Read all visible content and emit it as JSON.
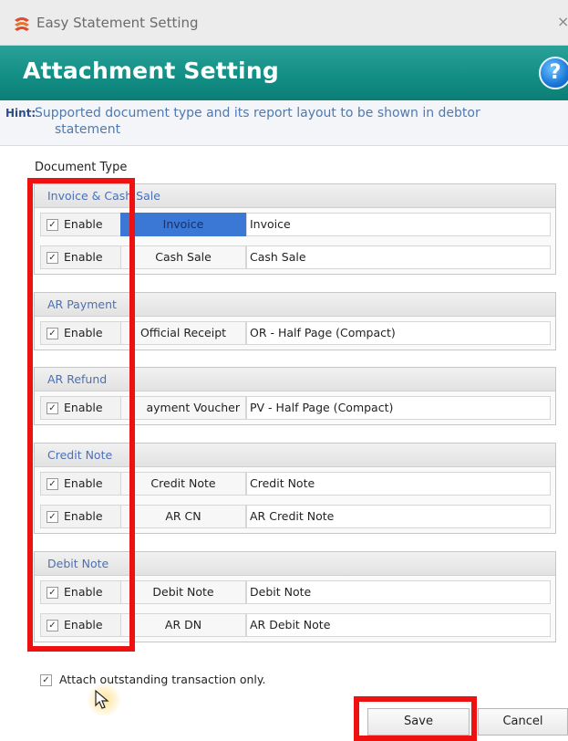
{
  "window": {
    "title": "Easy Statement Setting",
    "close_glyph": "×"
  },
  "header": {
    "title": "Attachment Setting",
    "help_glyph": "?"
  },
  "hint": {
    "label": "Hint:",
    "line1": "Supported document type and its report layout to be shown in debtor",
    "line2": "statement"
  },
  "document_type_label": "Document Type",
  "enable_label": "Enable",
  "groups": [
    {
      "name": "Invoice & Cash Sale",
      "rows": [
        {
          "enabled": true,
          "doc": "Invoice",
          "layout": "Invoice",
          "selected": true
        },
        {
          "enabled": true,
          "doc": "Cash Sale",
          "layout": "Cash Sale"
        }
      ]
    },
    {
      "name": "AR Payment",
      "rows": [
        {
          "enabled": true,
          "doc": "Official Receipt",
          "layout": "OR - Half Page (Compact)"
        }
      ]
    },
    {
      "name": "AR Refund",
      "rows": [
        {
          "enabled": true,
          "doc": "ayment Voucher",
          "layout": "PV - Half Page (Compact)"
        }
      ]
    },
    {
      "name": "Credit Note",
      "rows": [
        {
          "enabled": true,
          "doc": "Credit Note",
          "layout": "Credit Note"
        },
        {
          "enabled": true,
          "doc": "AR CN",
          "layout": "AR Credit Note"
        }
      ]
    },
    {
      "name": "Debit Note",
      "rows": [
        {
          "enabled": true,
          "doc": "Debit Note",
          "layout": "Debit Note"
        },
        {
          "enabled": true,
          "doc": "AR DN",
          "layout": "AR Debit Note"
        }
      ]
    }
  ],
  "attach_outstanding": {
    "checked": true,
    "label": "Attach outstanding transaction only."
  },
  "buttons": {
    "save": "Save",
    "cancel": "Cancel"
  },
  "colors": {
    "header": "#138f86",
    "highlight": "#ee1111",
    "selected_cell": "#3b78d6",
    "hint_text": "#4f79b0",
    "group_header_text": "#4b70b5"
  }
}
